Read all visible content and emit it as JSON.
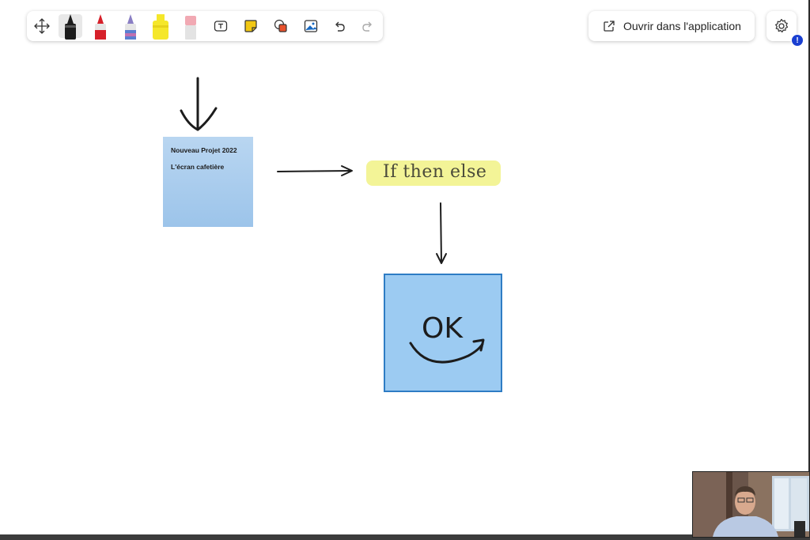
{
  "toolbar": {
    "tools": [
      {
        "name": "move-tool",
        "icon": "move-arrows-icon"
      },
      {
        "name": "black-pen",
        "icon": "pen-icon",
        "color": "#1c1c1c",
        "selected": true
      },
      {
        "name": "red-pen",
        "icon": "pen-icon",
        "color": "#d6202a"
      },
      {
        "name": "galaxy-pen",
        "icon": "pen-icon",
        "color": "#8a7fc4"
      },
      {
        "name": "highlighter",
        "icon": "highlighter-icon",
        "color": "#f5e72a"
      },
      {
        "name": "eraser",
        "icon": "eraser-icon",
        "color": "#f1a9b3"
      },
      {
        "name": "text-tool",
        "icon": "text-box-icon"
      },
      {
        "name": "sticky-note-tool",
        "icon": "sticky-note-icon",
        "color": "#f2c814"
      },
      {
        "name": "shapes-tool",
        "icon": "shapes-icon",
        "color": "#e8522d"
      },
      {
        "name": "image-tool",
        "icon": "image-icon",
        "color": "#1769c2"
      },
      {
        "name": "undo",
        "icon": "undo-icon"
      },
      {
        "name": "redo",
        "icon": "redo-icon"
      }
    ]
  },
  "header": {
    "open_in_app_label": "Ouvrir dans l'application",
    "notification_badge": "!"
  },
  "board": {
    "sticky_note": {
      "line1": "Nouveau Projet 2022",
      "line2": "L'écran cafetière"
    },
    "highlighted_text": "If then else",
    "ok_note": {
      "text": "OK"
    }
  },
  "colors": {
    "accent": "#1a3fd1",
    "sticky_blue": "#a9cdef",
    "highlight_yellow": "#f2f391",
    "ok_blue": "#9ccbf2"
  }
}
